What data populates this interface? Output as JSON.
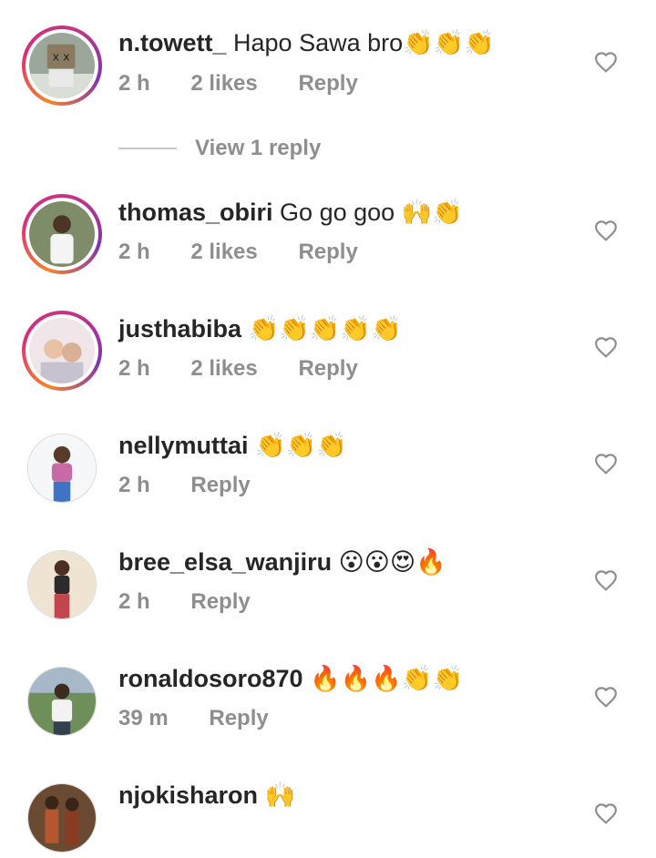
{
  "comments": [
    {
      "username": "n.towett_",
      "text": "Hapo Sawa bro👏👏👏",
      "time": "2 h",
      "likes": "2 likes",
      "reply": "Reply",
      "view_replies": "View 1 reply"
    },
    {
      "username": "thomas_obiri",
      "text": "Go go goo 🙌👏",
      "time": "2 h",
      "likes": "2 likes",
      "reply": "Reply"
    },
    {
      "username": "justhabiba",
      "text": "👏👏👏👏👏",
      "time": "2 h",
      "likes": "2 likes",
      "reply": "Reply"
    },
    {
      "username": "nellymuttai",
      "text": "👏👏👏",
      "time": "2 h",
      "reply": "Reply"
    },
    {
      "username": "bree_elsa_wanjiru",
      "text": "😮😮😍🔥",
      "time": "2 h",
      "reply": "Reply"
    },
    {
      "username": "ronaldosoro870",
      "text": "🔥🔥🔥👏👏",
      "time": "39 m",
      "reply": "Reply"
    },
    {
      "username": "njokisharon",
      "text": "🙌"
    }
  ]
}
